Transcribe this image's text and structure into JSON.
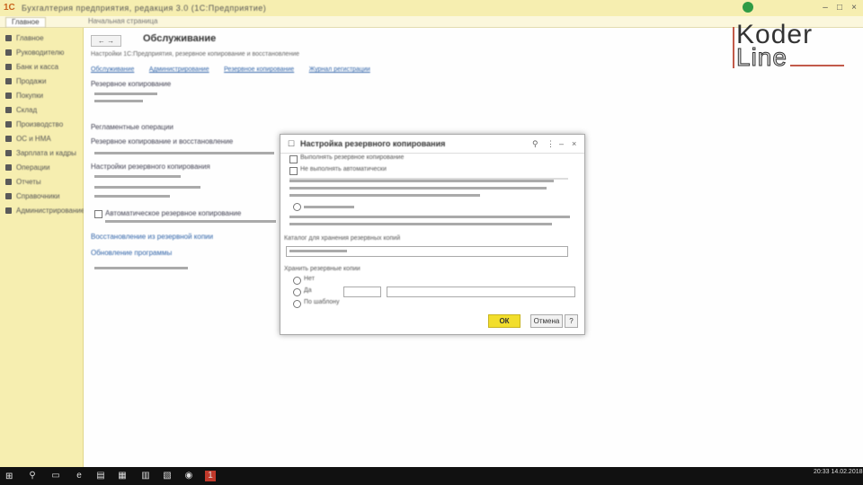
{
  "app": {
    "title": "Бухгалтерия предприятия, редакция 3.0 (1С:Предприятие)",
    "logo_glyph": "1С",
    "window_controls": [
      "–",
      "□",
      "×"
    ]
  },
  "tabs": [
    {
      "label": "Главное",
      "active": true
    },
    {
      "label": "Начальная страница",
      "active": false
    }
  ],
  "sidebar": {
    "items": [
      {
        "label": "Главное",
        "icon": "home-icon"
      },
      {
        "label": "Руководителю",
        "icon": "chart-icon"
      },
      {
        "label": "Банк и касса",
        "icon": "bank-icon"
      },
      {
        "label": "Продажи",
        "icon": "sales-icon"
      },
      {
        "label": "Покупки",
        "icon": "cart-icon"
      },
      {
        "label": "Склад",
        "icon": "box-icon"
      },
      {
        "label": "Производство",
        "icon": "factory-icon"
      },
      {
        "label": "ОС и НМА",
        "icon": "building-icon"
      },
      {
        "label": "Зарплата и кадры",
        "icon": "person-icon"
      },
      {
        "label": "Операции",
        "icon": "ops-icon"
      },
      {
        "label": "Отчеты",
        "icon": "report-icon"
      },
      {
        "label": "Справочники",
        "icon": "book-icon"
      },
      {
        "label": "Администрирование",
        "icon": "gear-icon"
      }
    ]
  },
  "main": {
    "back_label": "←  →",
    "title": "Обслуживание",
    "subtitle": "Настройки 1С:Предприятия, резервное копирование и восстановление",
    "links": [
      "Обслуживание",
      "Администрирование",
      "Резервное копирование",
      "Журнал регистрации"
    ],
    "sections": [
      "Резервное копирование",
      "Регламентные операции",
      "Резервное копирование и восстановление",
      "Настройки резервного копирования",
      "Автоматическое резервное копирование",
      "Восстановление из резервной копии",
      "Обновление программы"
    ]
  },
  "brand": {
    "line1": "Koder",
    "line2": "Line"
  },
  "dialog": {
    "title": "Настройка резервного копирования",
    "ok_label": "ОК",
    "cancel_label": "Отмена",
    "help_label": "?",
    "option1": "Выполнять резервное копирование",
    "option2": "Не выполнять автоматически",
    "radio1": "Нет",
    "radio2": "Да",
    "radio3": "По шаблону",
    "field_label_1": "Каталог для хранения резервных копий",
    "field_label_2": "Хранить резервные копии"
  },
  "taskbar": {
    "start_glyph": "⊞",
    "search_glyph": "⚲",
    "clock": "20:33\n14.02.2018"
  }
}
